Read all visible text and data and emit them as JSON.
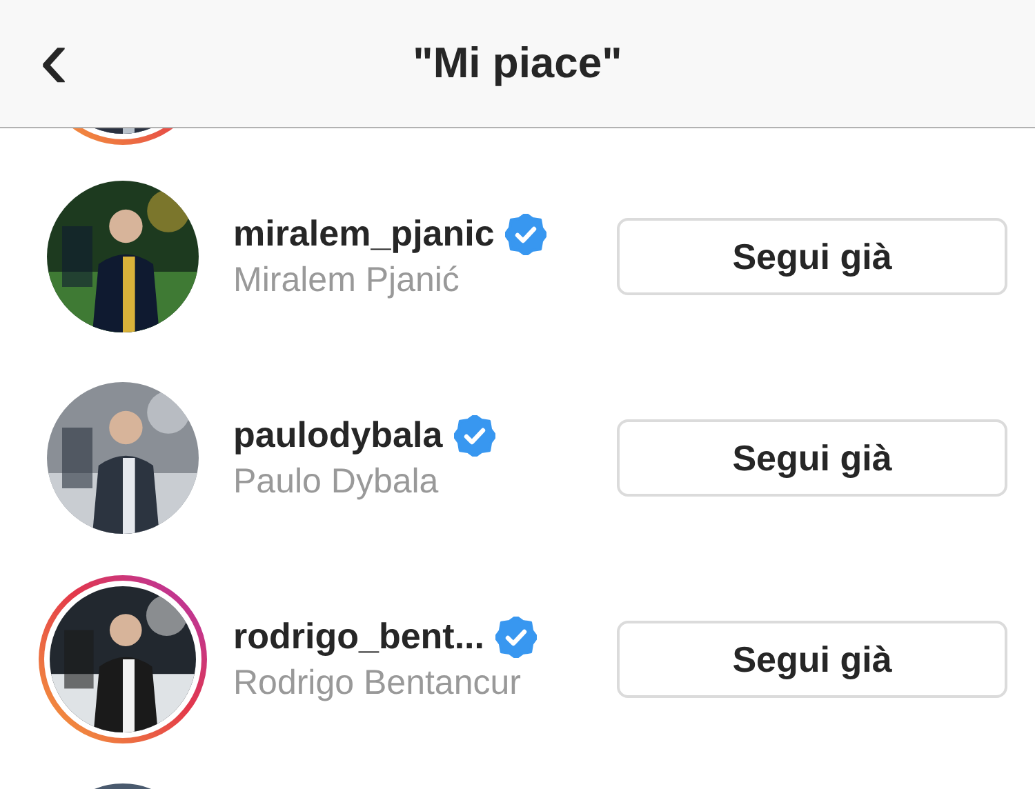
{
  "header": {
    "back": "‹",
    "title": "\"Mi piace\""
  },
  "above": {
    "has_story": true
  },
  "users": [
    {
      "username": "miralem_pjanic",
      "full_name": "Miralem Pjanić",
      "verified": true,
      "has_story": false,
      "button": "Segui già"
    },
    {
      "username": "paulodybala",
      "full_name": "Paulo Dybala",
      "verified": true,
      "has_story": false,
      "button": "Segui già"
    },
    {
      "username": "rodrigo_bent...",
      "full_name": "Rodrigo Bentancur",
      "verified": true,
      "has_story": true,
      "button": "Segui già"
    }
  ],
  "below": {
    "has_story": false
  }
}
